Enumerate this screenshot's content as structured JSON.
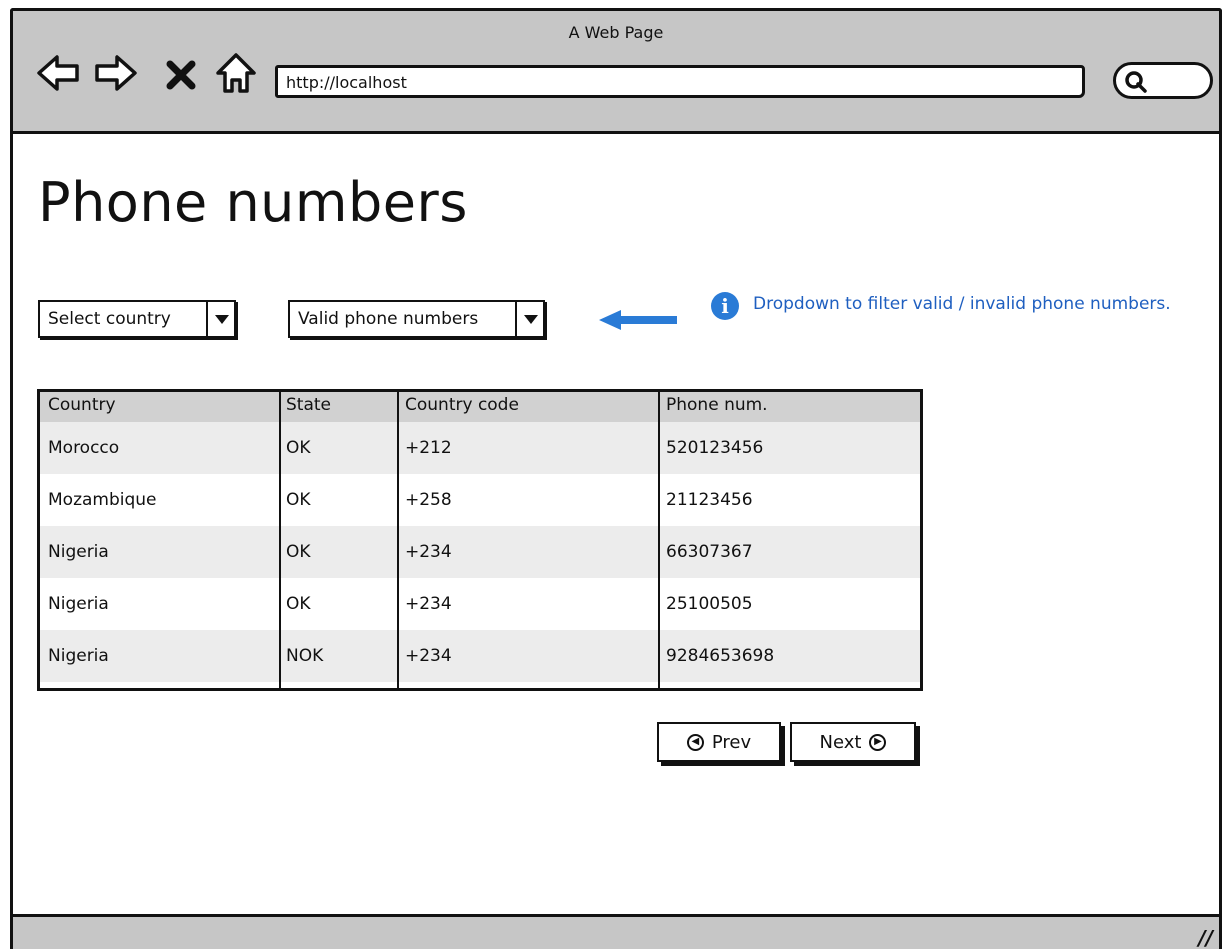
{
  "window": {
    "title": "A Web Page"
  },
  "browser": {
    "url": "http://localhost",
    "nav_icons": [
      "back-arrow-icon",
      "forward-arrow-icon",
      "stop-x-icon",
      "home-icon"
    ],
    "search_icon": "search-icon"
  },
  "page": {
    "title": "Phone numbers",
    "filters": {
      "country": {
        "value": "Select country"
      },
      "validity": {
        "value": "Valid phone numbers"
      }
    },
    "annotation": {
      "icon": "info-icon",
      "text": "Dropdown to filter valid / invalid phone numbers.",
      "color": "#2a7bd6"
    },
    "table": {
      "columns": [
        "Country",
        "State",
        "Country code",
        "Phone num."
      ],
      "rows": [
        [
          "Morocco",
          "OK",
          "+212",
          "520123456"
        ],
        [
          "Mozambique",
          "OK",
          "+258",
          "21123456"
        ],
        [
          "Nigeria",
          "OK",
          "+234",
          "66307367"
        ],
        [
          "Nigeria",
          "OK",
          "+234",
          "25100505"
        ],
        [
          "Nigeria",
          "NOK",
          "+234",
          "9284653698"
        ]
      ]
    },
    "pagination": {
      "prev_label": "Prev",
      "next_label": "Next"
    }
  }
}
